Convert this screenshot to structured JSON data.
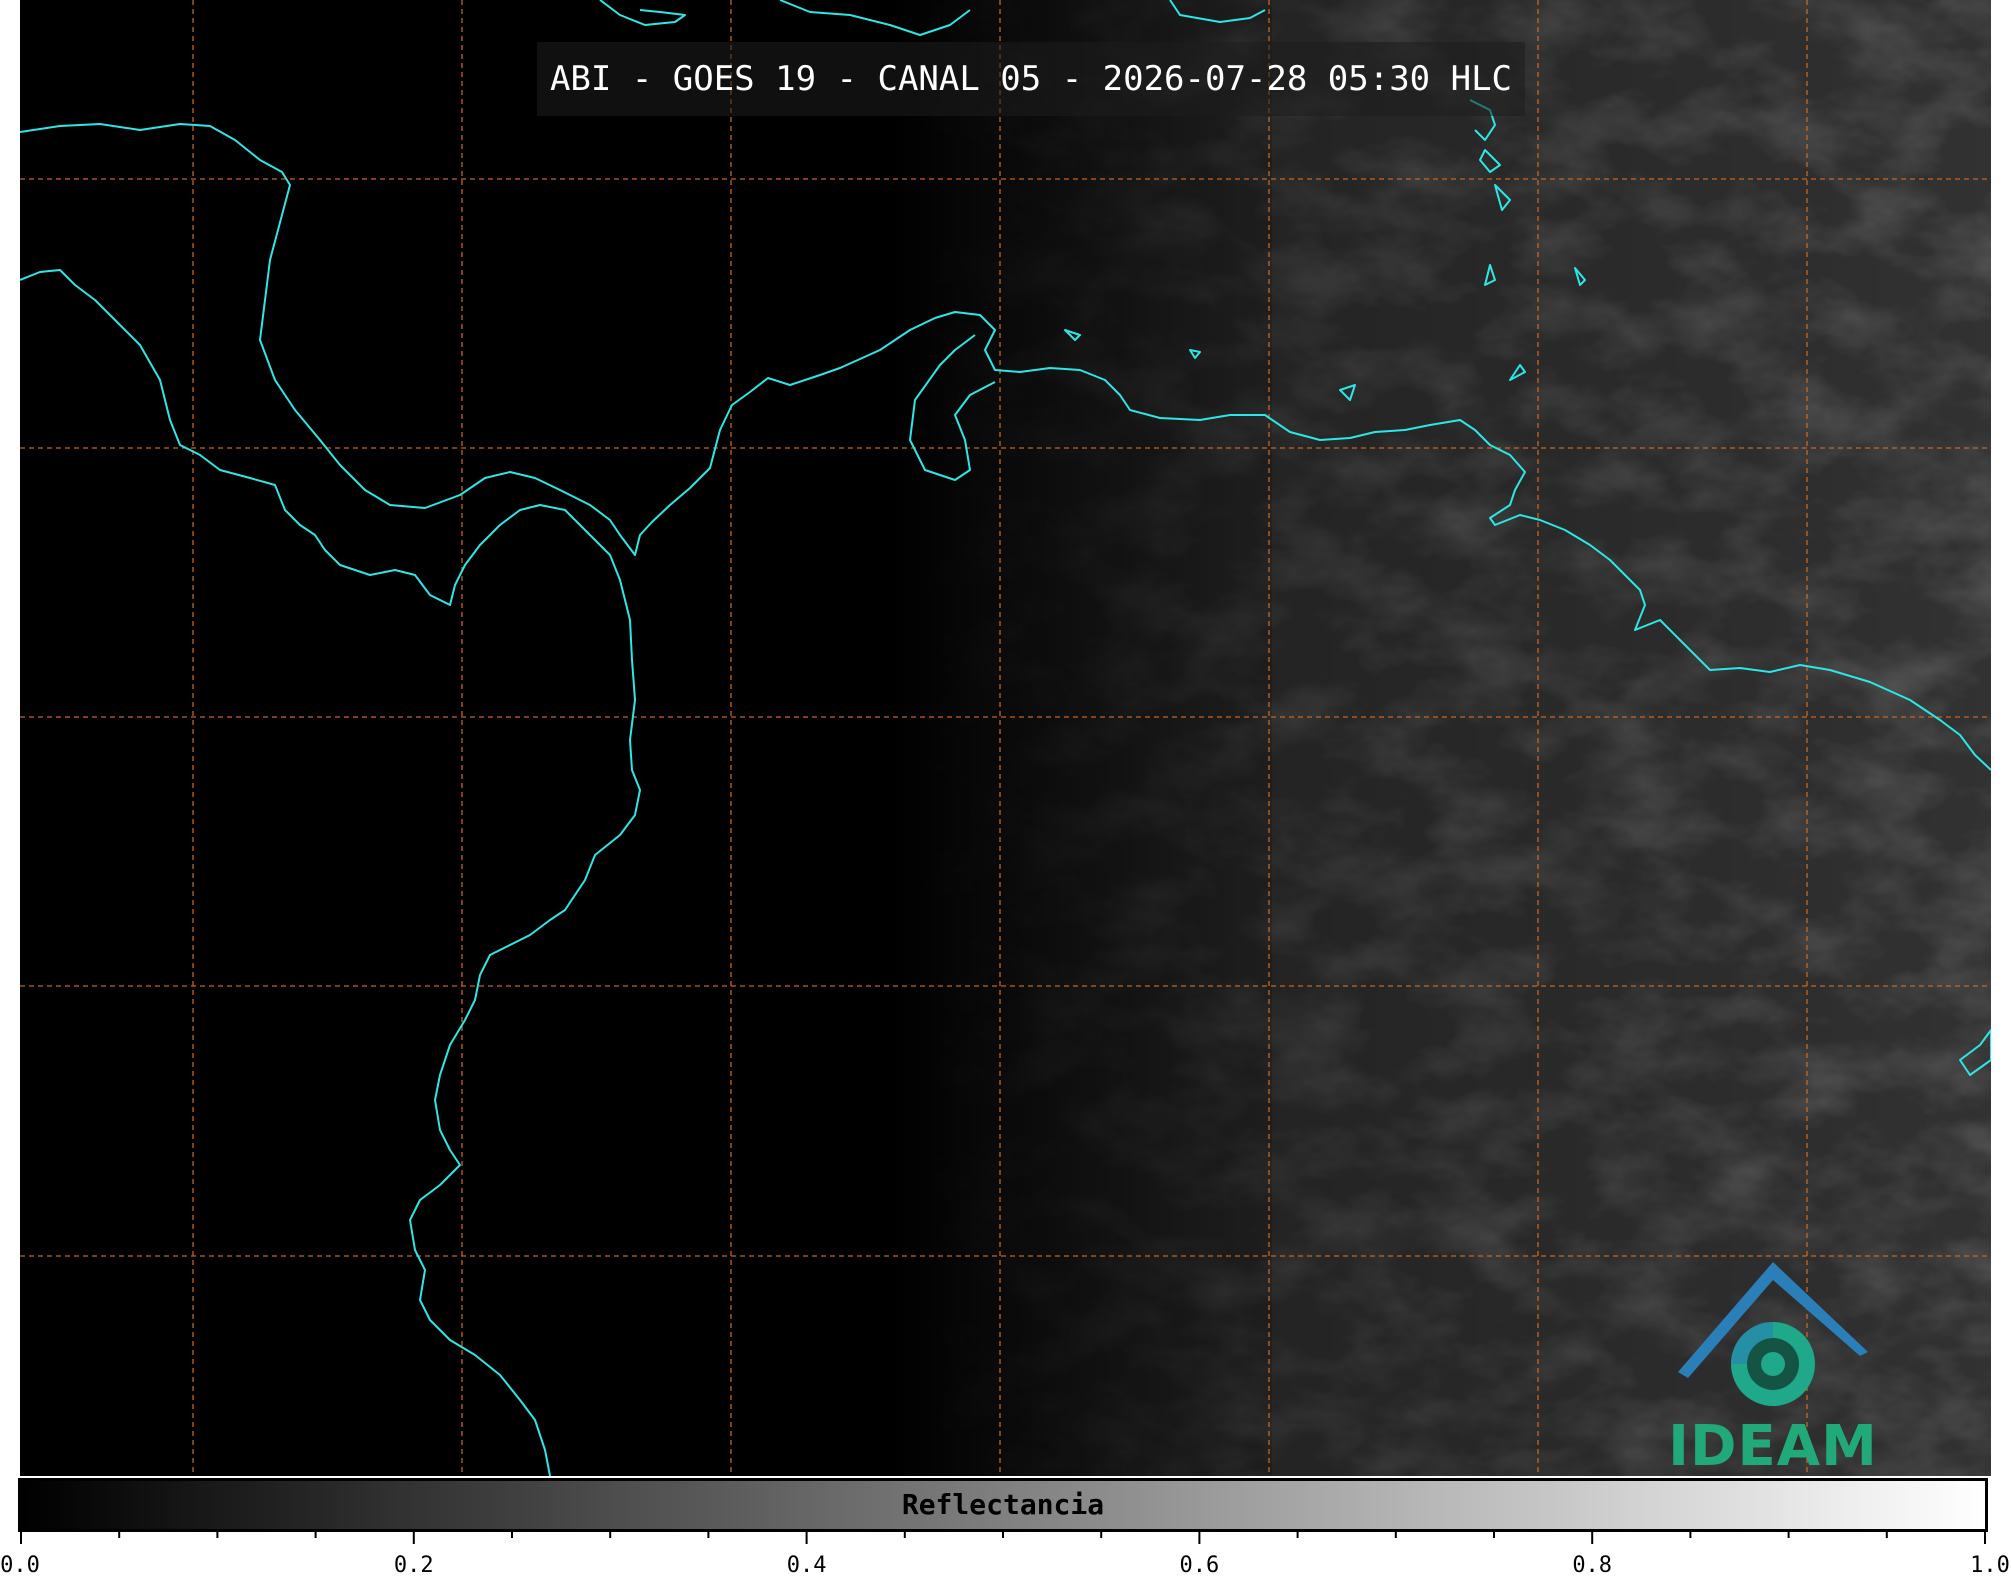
{
  "title": "ABI - GOES 19 - CANAL 05 - 2026-07-28 05:30 HLC",
  "logo": {
    "text": "IDEAM",
    "colors": {
      "arch": "#2a7fb8",
      "swirl": "#1fa88a",
      "text": "#21a97a"
    }
  },
  "colorbar": {
    "label": "Reflectancia",
    "min": 0.0,
    "max": 1.0,
    "tick_labels": [
      "0.0",
      "0.2",
      "0.4",
      "0.6",
      "0.8",
      "1.0"
    ],
    "tick_values": [
      0.0,
      0.2,
      0.4,
      0.6,
      0.8,
      1.0
    ],
    "minor_step": 0.05,
    "colormap": "gray"
  },
  "map": {
    "coastline_color": "#2ee6e6",
    "grid_color": "#d2691e",
    "grid_style": "dashed",
    "background": "#000000"
  }
}
